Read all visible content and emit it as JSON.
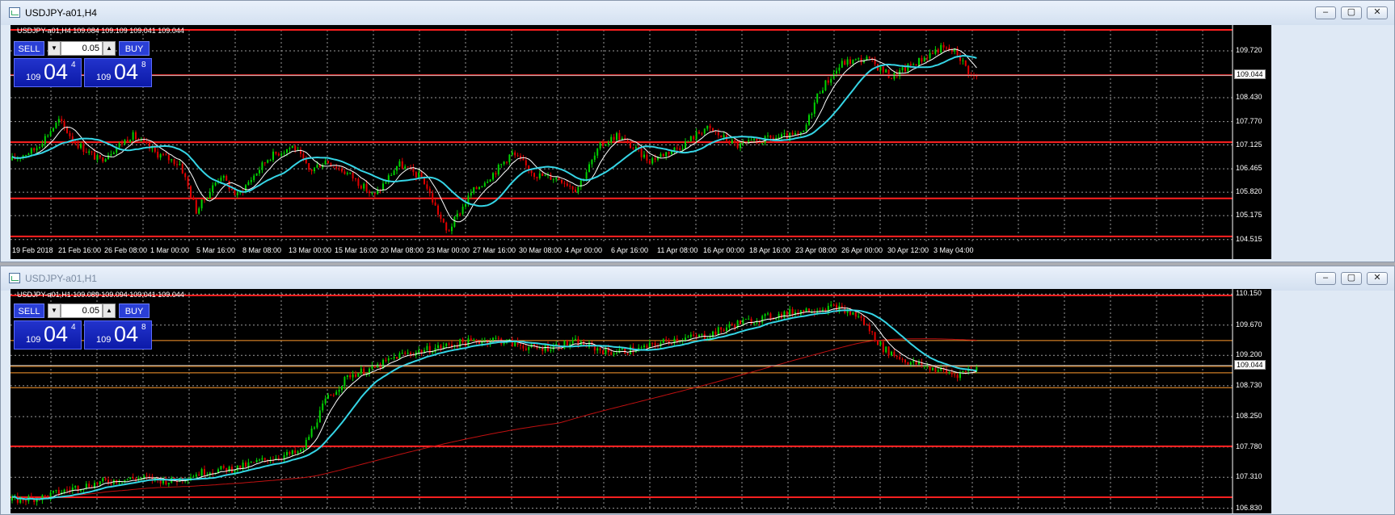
{
  "colors": {
    "bull": "#00d200",
    "bear": "#e00000",
    "ma_fast": "#ffffff",
    "ma_slow": "#35d5e6",
    "hline": "#ff2020",
    "ma_long": "#c01010",
    "orange_line": "#ff9b2e"
  },
  "icons": {
    "minimize": "minimize-icon",
    "maximize": "maximize-icon",
    "close": "close-icon",
    "app": "chart-window-icon",
    "spin_down": "chevron-down-icon",
    "spin_up": "chevron-up-icon"
  },
  "top": {
    "title": "USDJPY-a01,H4",
    "symbol_line": "USDJPY-a01,H4  109.084  109.109  109.041  109.044",
    "trade": {
      "sell": "SELL",
      "buy": "BUY",
      "lot": "0.05",
      "bid_small": "109",
      "bid_big": "04",
      "bid_sup": "4",
      "ask_small": "109",
      "ask_big": "04",
      "ask_sup": "8"
    },
    "y_labels": [
      "109.720",
      "108.430",
      "107.770",
      "107.125",
      "106.465",
      "105.820",
      "105.175",
      "104.515"
    ],
    "current_price": "109.044",
    "x_labels": [
      "19 Feb 2018",
      "21 Feb 16:00",
      "26 Feb 08:00",
      "1 Mar 00:00",
      "5 Mar 16:00",
      "8 Mar 08:00",
      "13 Mar 00:00",
      "15 Mar 16:00",
      "20 Mar 08:00",
      "23 Mar 00:00",
      "27 Mar 16:00",
      "30 Mar 08:00",
      "4 Apr 00:00",
      "6 Apr 16:00",
      "11 Apr 08:00",
      "16 Apr 00:00",
      "18 Apr 16:00",
      "23 Apr 08:00",
      "26 Apr 00:00",
      "30 Apr 12:00",
      "3 May 04:00"
    ],
    "hlines": [
      110.3,
      109.05,
      107.2,
      105.65,
      104.6
    ],
    "y_range": [
      104.42,
      110.3
    ],
    "anchors": [
      [
        0,
        106.7
      ],
      [
        30,
        107.0
      ],
      [
        60,
        107.8
      ],
      [
        80,
        107.2
      ],
      [
        110,
        106.7
      ],
      [
        150,
        107.4
      ],
      [
        180,
        106.9
      ],
      [
        210,
        106.6
      ],
      [
        230,
        105.3
      ],
      [
        260,
        106.3
      ],
      [
        280,
        105.7
      ],
      [
        320,
        106.8
      ],
      [
        350,
        107.1
      ],
      [
        370,
        106.4
      ],
      [
        390,
        106.7
      ],
      [
        420,
        106.3
      ],
      [
        450,
        105.7
      ],
      [
        480,
        106.6
      ],
      [
        510,
        106.2
      ],
      [
        540,
        104.7
      ],
      [
        570,
        105.8
      ],
      [
        600,
        106.4
      ],
      [
        620,
        106.9
      ],
      [
        650,
        106.3
      ],
      [
        680,
        106.2
      ],
      [
        700,
        105.9
      ],
      [
        730,
        107.1
      ],
      [
        750,
        107.4
      ],
      [
        790,
        106.7
      ],
      [
        830,
        107.1
      ],
      [
        860,
        107.6
      ],
      [
        900,
        107.1
      ],
      [
        940,
        107.3
      ],
      [
        980,
        107.4
      ],
      [
        1000,
        108.6
      ],
      [
        1030,
        109.4
      ],
      [
        1060,
        109.5
      ],
      [
        1090,
        109.0
      ],
      [
        1120,
        109.4
      ],
      [
        1150,
        109.8
      ],
      [
        1170,
        109.7
      ],
      [
        1190,
        109.0
      ],
      [
        1200,
        109.05
      ]
    ]
  },
  "bottom": {
    "title": "USDJPY-a01,H1",
    "symbol_line": "USDJPY-a01,H1  109.089  109.094  109.041  109.044",
    "trade": {
      "sell": "SELL",
      "buy": "BUY",
      "lot": "0.05",
      "bid_small": "109",
      "bid_big": "04",
      "bid_sup": "4",
      "ask_small": "109",
      "ask_big": "04",
      "ask_sup": "8"
    },
    "y_labels": [
      "110.150",
      "109.670",
      "109.200",
      "108.730",
      "108.250",
      "107.780",
      "107.310",
      "106.830"
    ],
    "current_price": "109.044",
    "hlines": [
      110.13,
      107.79,
      107.0
    ],
    "orange_lines": [
      109.43,
      109.03,
      108.93,
      108.7
    ],
    "y_range": [
      106.8,
      110.18
    ],
    "anchors": [
      [
        0,
        106.95
      ],
      [
        40,
        107.0
      ],
      [
        80,
        107.15
      ],
      [
        120,
        107.25
      ],
      [
        160,
        107.3
      ],
      [
        200,
        107.25
      ],
      [
        240,
        107.4
      ],
      [
        280,
        107.45
      ],
      [
        320,
        107.6
      ],
      [
        360,
        107.7
      ],
      [
        390,
        108.5
      ],
      [
        420,
        108.9
      ],
      [
        450,
        109.0
      ],
      [
        480,
        109.2
      ],
      [
        520,
        109.3
      ],
      [
        560,
        109.4
      ],
      [
        600,
        109.45
      ],
      [
        650,
        109.3
      ],
      [
        700,
        109.4
      ],
      [
        740,
        109.25
      ],
      [
        780,
        109.3
      ],
      [
        820,
        109.45
      ],
      [
        860,
        109.5
      ],
      [
        900,
        109.7
      ],
      [
        940,
        109.8
      ],
      [
        980,
        109.9
      ],
      [
        1020,
        109.95
      ],
      [
        1050,
        109.8
      ],
      [
        1080,
        109.3
      ],
      [
        1110,
        109.1
      ],
      [
        1140,
        109.0
      ],
      [
        1170,
        108.9
      ],
      [
        1200,
        109.04
      ]
    ]
  }
}
